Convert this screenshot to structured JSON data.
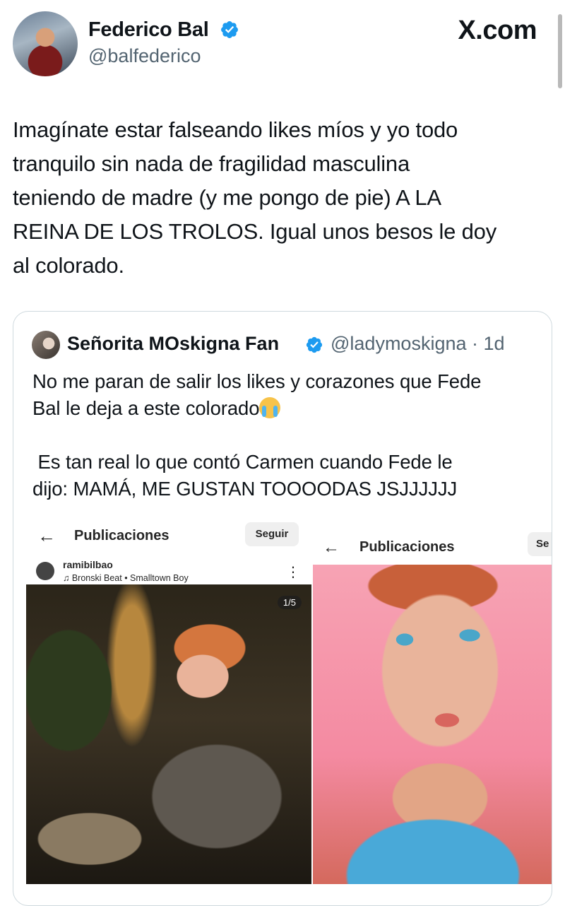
{
  "header": {
    "name": "Federico Bal",
    "handle": "@balfederico",
    "brand": "X.com",
    "brand_color": "#0f1419",
    "verified_color": "#1d9bf0"
  },
  "tweet": {
    "text": "Imagínate estar falseando likes míos y yo todo\ntranquilo sin nada de fragilidad masculina\nteniendo de madre (y me pongo de pie) A LA\nREINA DE LOS TROLOS. Igual unos besos le doy\nal colorado."
  },
  "quote": {
    "name": "Señorita MOskigna Fan",
    "handle": "@ladymoskigna · 1d",
    "text_part1": "No me paran de salir los likes y corazones que Fede\nBal le deja a este colorado",
    "emoji": "loudly-crying-face-icon",
    "text_part2": "\n\n Es tan real lo que contó Carmen cuando Fede le\ndijo: MAMÁ, ME GUSTAN TOOOODAS JSJJJJJJ"
  },
  "media_left": {
    "title": "Publicaciones",
    "follow": "Seguir",
    "user": "ramibilbao",
    "song": "♫ Bronski Beat • Smalltown Boy",
    "counter": "1/5"
  },
  "media_right": {
    "title": "Publicaciones",
    "follow": "Se"
  }
}
